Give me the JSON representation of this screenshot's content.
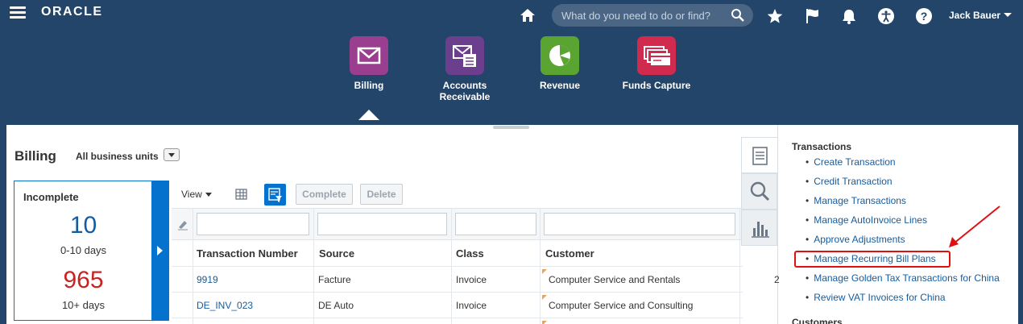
{
  "header": {
    "logo": "ORACLE",
    "search_placeholder": "What do you need to do or find?",
    "user_name": "Jack Bauer"
  },
  "springboard": {
    "items": [
      {
        "label": "Billing",
        "color": "#9a3f8f"
      },
      {
        "label": "Accounts Receivable",
        "color": "#6b3e8e"
      },
      {
        "label": "Revenue",
        "color": "#5aa532"
      },
      {
        "label": "Funds Capture",
        "color": "#d12a4f"
      }
    ]
  },
  "page": {
    "title": "Billing",
    "business_unit": "All business units"
  },
  "incomplete": {
    "title": "Incomplete",
    "count1": "10",
    "label1": "0-10 days",
    "count2": "965",
    "label2": "10+ days",
    "count1_color": "#145c9e",
    "count2_color": "#c82323"
  },
  "toolbar": {
    "view_label": "View",
    "complete_label": "Complete",
    "delete_label": "Delete"
  },
  "table": {
    "columns": [
      "Transaction Number",
      "Source",
      "Class",
      "Customer"
    ],
    "rows": [
      {
        "number": "9919",
        "source": "Facture",
        "class": "Invoice",
        "customer": "Computer Service and Rentals",
        "extra": "2"
      },
      {
        "number": "DE_INV_023",
        "source": "DE Auto",
        "class": "Invoice",
        "customer": "Computer Service and Consulting",
        "extra": ""
      }
    ]
  },
  "tasks": {
    "heading": "Transactions",
    "items": [
      "Create Transaction",
      "Credit Transaction",
      "Manage Transactions",
      "Manage AutoInvoice Lines",
      "Approve Adjustments",
      "Manage Recurring Bill Plans",
      "Manage Golden Tax Transactions for China",
      "Review VAT Invoices for China"
    ],
    "next_heading": "Customers",
    "highlighted_index": 5
  },
  "colors": {
    "header_bg": "#234569",
    "link": "#145c9e",
    "accent_blue": "#0572ce",
    "highlight_red": "#e01010"
  }
}
